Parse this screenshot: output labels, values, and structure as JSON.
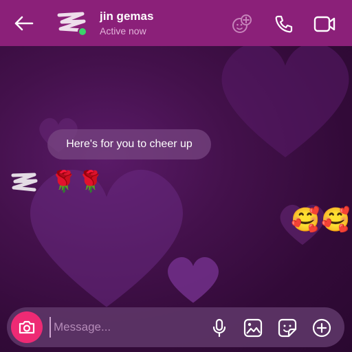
{
  "header": {
    "contact_name": "jin gemas",
    "status": "Active now",
    "icons": [
      "back-arrow-icon",
      "avatar",
      "effects-icon",
      "phone-icon",
      "video-icon"
    ],
    "color": "#8b2079"
  },
  "messages": [
    {
      "direction": "incoming",
      "text": "Here's for you to cheer up"
    },
    {
      "direction": "incoming",
      "emoji": "🌹🌹"
    },
    {
      "direction": "outgoing",
      "emoji": "🥰🥰"
    }
  ],
  "composer": {
    "placeholder": "Message...",
    "icons": [
      "camera-icon",
      "microphone-icon",
      "gallery-icon",
      "sticker-icon",
      "plus-icon"
    ],
    "camera_color": "#ee2a74"
  }
}
